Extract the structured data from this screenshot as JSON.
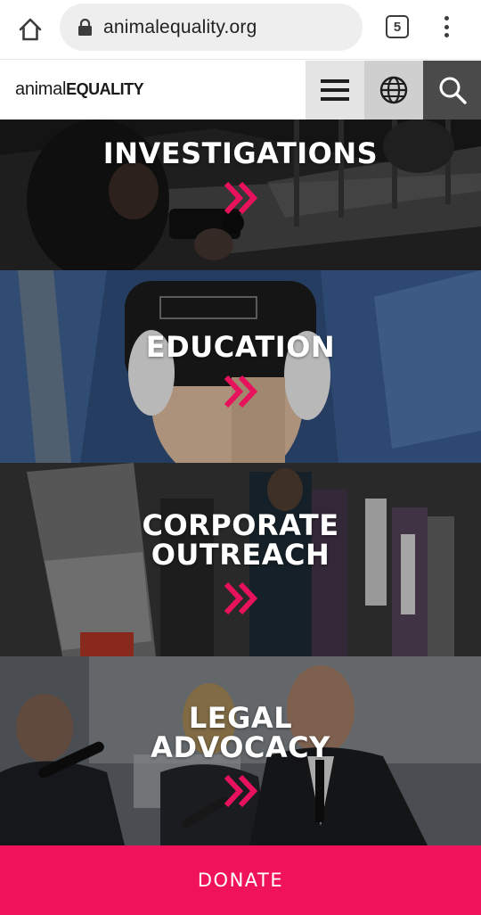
{
  "browser": {
    "url": "animalequality.org",
    "tab_count": "5"
  },
  "site": {
    "logo_light": "animal",
    "logo_bold": "EQUALITY"
  },
  "panels": [
    {
      "title": "INVESTIGATIONS"
    },
    {
      "title": "EDUCATION"
    },
    {
      "title": "CORPORATE\nOUTREACH"
    },
    {
      "title": "LEGAL\nADVOCACY"
    }
  ],
  "donate": {
    "label": "DONATE"
  },
  "colors": {
    "accent": "#f0125a",
    "chevron": "#e8125c"
  },
  "icons": [
    "home-icon",
    "lock-icon",
    "tab-switcher-icon",
    "overflow-menu-icon",
    "hamburger-icon",
    "globe-icon",
    "search-icon",
    "double-chevron-icon"
  ]
}
